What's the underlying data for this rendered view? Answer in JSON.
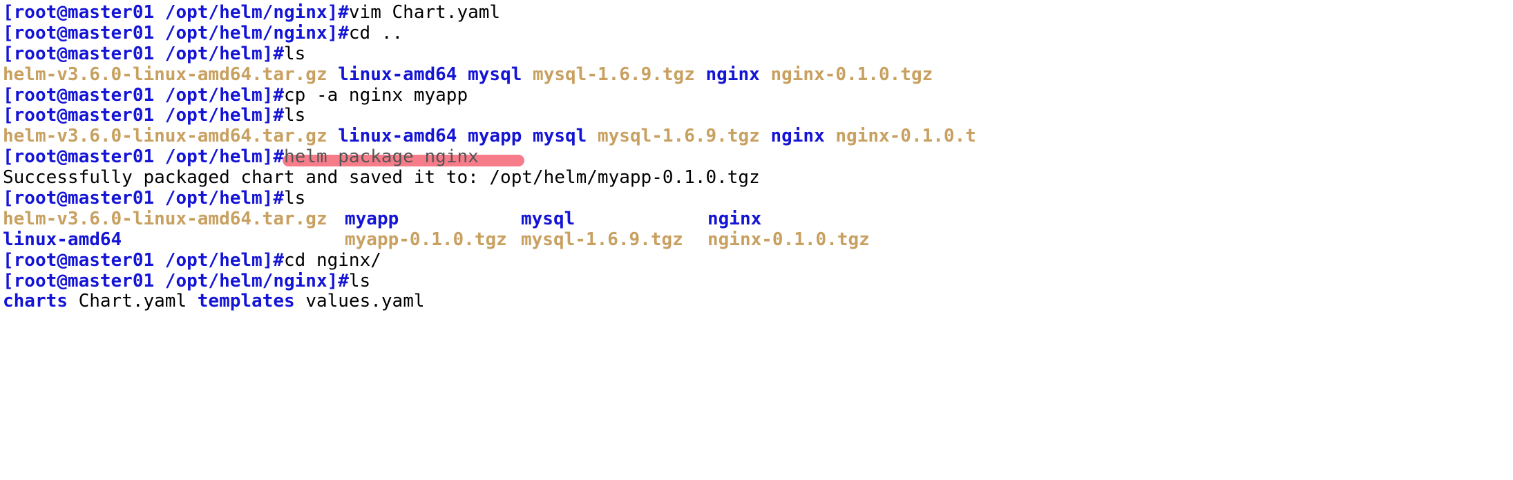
{
  "lines": {
    "l1_prompt": "[root@master01 /opt/helm/nginx]#",
    "l1_cmd": "vim Chart.yaml",
    "l2_prompt": "[root@master01 /opt/helm/nginx]#",
    "l2_cmd": "cd ..",
    "l3_prompt": "[root@master01 /opt/helm]#",
    "l3_cmd": "ls",
    "l5_prompt": "[root@master01 /opt/helm]#",
    "l5_cmd": "cp -a nginx myapp",
    "l6_prompt": "[root@master01 /opt/helm]#",
    "l6_cmd": "ls",
    "l8_prompt": "[root@master01 /opt/helm]#",
    "l8_cmd": "helm package nginx",
    "l9_msg": "Successfully packaged chart and saved it to: /opt/helm/myapp-0.1.0.tgz",
    "l10_prompt": "[root@master01 /opt/helm]#",
    "l10_cmd": "ls",
    "l13_prompt": "[root@master01 /opt/helm]#",
    "l13_cmd": "cd nginx/",
    "l14_prompt": "[root@master01 /opt/helm/nginx]#",
    "l14_cmd": "ls"
  },
  "ls1": {
    "i1": "helm-v3.6.0-linux-amd64.tar.gz",
    "i2": "linux-amd64",
    "i3": "mysql",
    "i4": "mysql-1.6.9.tgz",
    "i5": "nginx",
    "i6": "nginx-0.1.0.tgz"
  },
  "ls2": {
    "i1": "helm-v3.6.0-linux-amd64.tar.gz",
    "i2": "linux-amd64",
    "i3": "myapp",
    "i4": "mysql",
    "i5": "mysql-1.6.9.tgz",
    "i6": "nginx",
    "i7": "nginx-0.1.0.t"
  },
  "ls3a": {
    "c1": "helm-v3.6.0-linux-amd64.tar.gz",
    "c2": "myapp",
    "c3": "mysql",
    "c4": "nginx"
  },
  "ls3b": {
    "c1": "linux-amd64",
    "c2": "myapp-0.1.0.tgz",
    "c3": "mysql-1.6.9.tgz",
    "c4": "nginx-0.1.0.tgz"
  },
  "ls4": {
    "i1": "charts",
    "i2": "Chart.yaml",
    "i3": "templates",
    "i4": "values.yaml"
  }
}
